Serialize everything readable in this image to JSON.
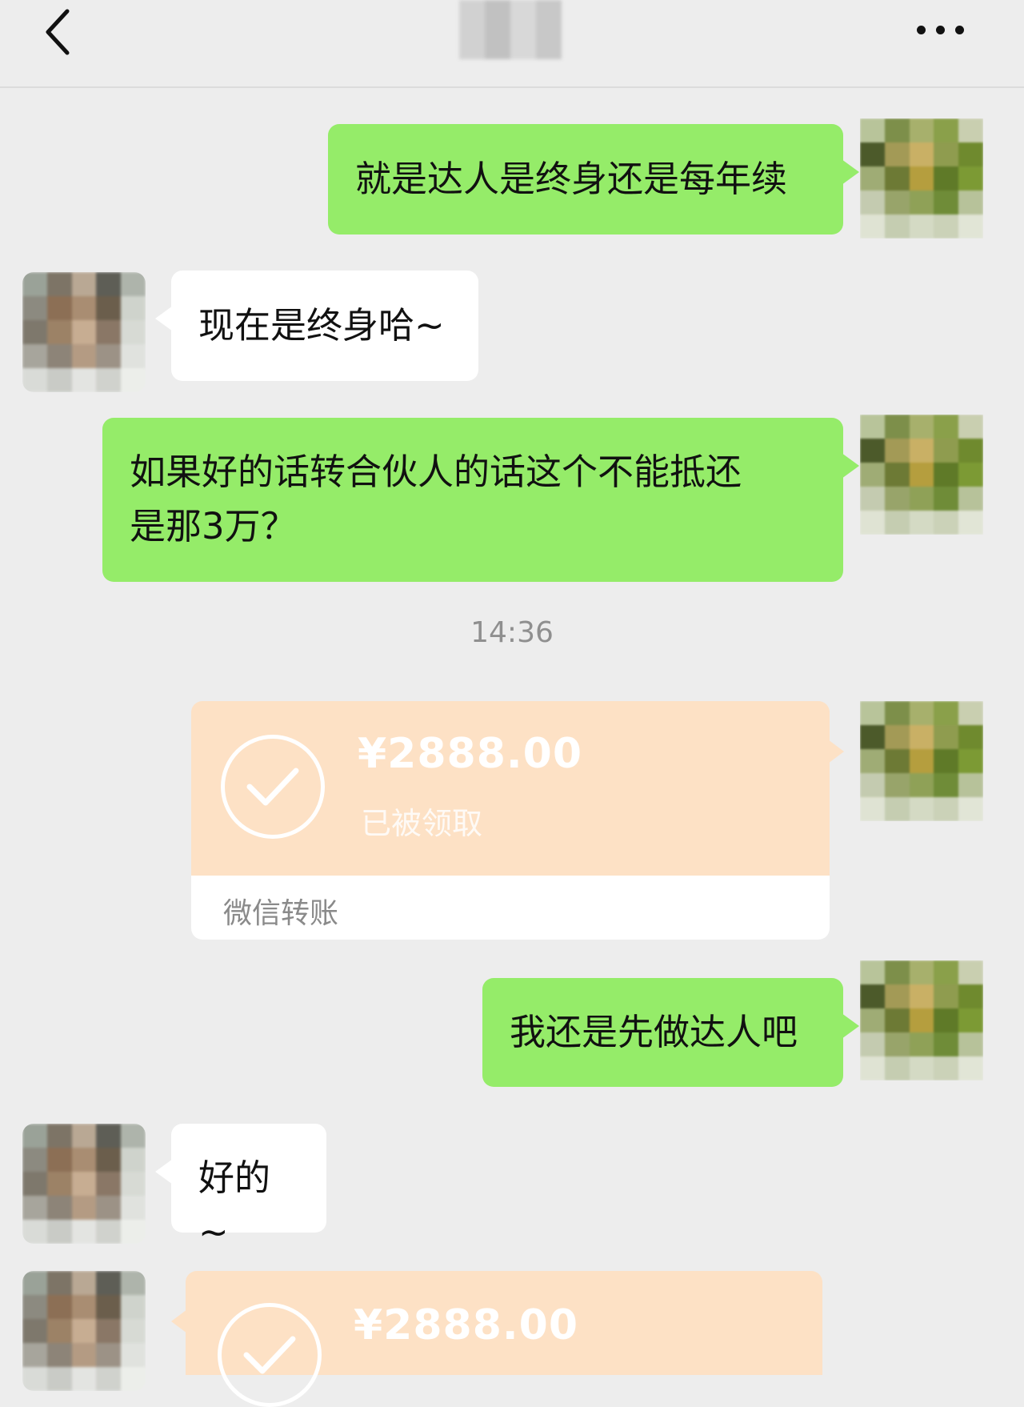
{
  "header": {
    "back_icon": "chevron-left-icon",
    "more_icon": "more-dots-icon"
  },
  "messages": [
    {
      "from": "self",
      "lines": [
        "就是达人是终身还是每年续"
      ]
    },
    {
      "from": "other",
      "lines": [
        "现在是终身哈~"
      ]
    },
    {
      "from": "self",
      "lines": [
        "如果好的话转合伙人的话这个不能抵还",
        "是那3万？"
      ]
    },
    {
      "from": "self",
      "type": "transfer",
      "amount": "¥2888.00",
      "status": "已被领取",
      "footer": "微信转账"
    },
    {
      "from": "self",
      "lines": [
        "我还是先做达人吧"
      ]
    },
    {
      "from": "other",
      "lines": [
        "好的~"
      ]
    },
    {
      "from": "other",
      "type": "transfer",
      "amount": "¥2888.00"
    }
  ],
  "timestamp": "14:36",
  "colors": {
    "background": "#ededed",
    "self_bubble": "#95ec69",
    "other_bubble": "#ffffff",
    "transfer": "#fde1c5"
  }
}
